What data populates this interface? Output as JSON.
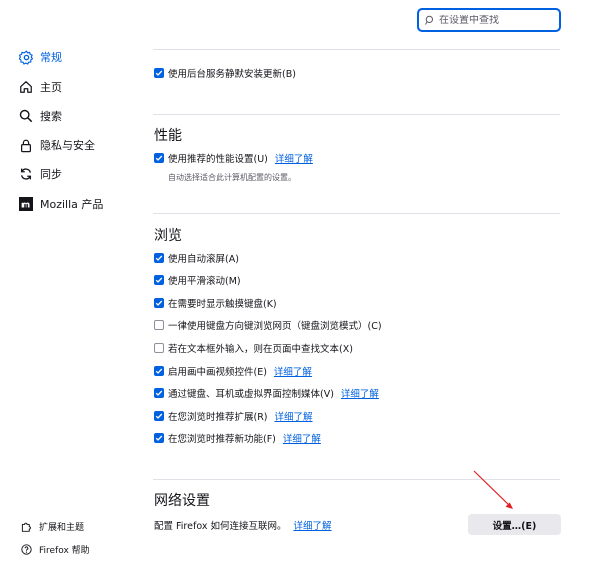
{
  "search": {
    "placeholder": "在设置中查找",
    "value": ""
  },
  "sidebar": {
    "items": [
      {
        "label": "常规",
        "icon": "gear-icon",
        "selected": true
      },
      {
        "label": "主页",
        "icon": "home-icon"
      },
      {
        "label": "搜索",
        "icon": "search-icon"
      },
      {
        "label": "隐私与安全",
        "icon": "lock-icon"
      },
      {
        "label": "同步",
        "icon": "sync-icon"
      },
      {
        "label": "Mozilla 产品",
        "icon": "mozilla-logo-icon"
      }
    ],
    "footer": [
      {
        "label": "扩展和主题",
        "icon": "puzzle-icon"
      },
      {
        "label": "Firefox 帮助",
        "icon": "help-icon"
      }
    ]
  },
  "updates": {
    "background_service": {
      "label": "使用后台服务静默安装更新(B)",
      "checked": true
    }
  },
  "performance": {
    "heading": "性能",
    "recommended": {
      "label": "使用推荐的性能设置(U)",
      "checked": true,
      "link": "详细了解"
    },
    "description": "自动选择适合此计算机配置的设置。"
  },
  "browsing": {
    "heading": "浏览",
    "options": [
      {
        "label": "使用自动滚屏(A)",
        "checked": true,
        "link": ""
      },
      {
        "label": "使用平滑滚动(M)",
        "checked": true,
        "link": ""
      },
      {
        "label": "在需要时显示触摸键盘(K)",
        "checked": true,
        "link": ""
      },
      {
        "label": "一律使用键盘方向键浏览网页（键盘浏览模式）(C)",
        "checked": false,
        "link": ""
      },
      {
        "label": "若在文本框外输入，则在页面中查找文本(X)",
        "checked": false,
        "link": ""
      },
      {
        "label": "启用画中画视频控件(E)",
        "checked": true,
        "link": "详细了解"
      },
      {
        "label": "通过键盘、耳机或虚拟界面控制媒体(V)",
        "checked": true,
        "link": "详细了解"
      },
      {
        "label": "在您浏览时推荐扩展(R)",
        "checked": true,
        "link": "详细了解"
      },
      {
        "label": "在您浏览时推荐新功能(F)",
        "checked": true,
        "link": "详细了解"
      }
    ]
  },
  "network": {
    "heading": "网络设置",
    "text": "配置 Firefox 如何连接互联网。",
    "link": "详细了解",
    "button": "设置…(E)"
  },
  "colors": {
    "accent": "#0061e0",
    "annotation_arrow": "#e02020"
  }
}
